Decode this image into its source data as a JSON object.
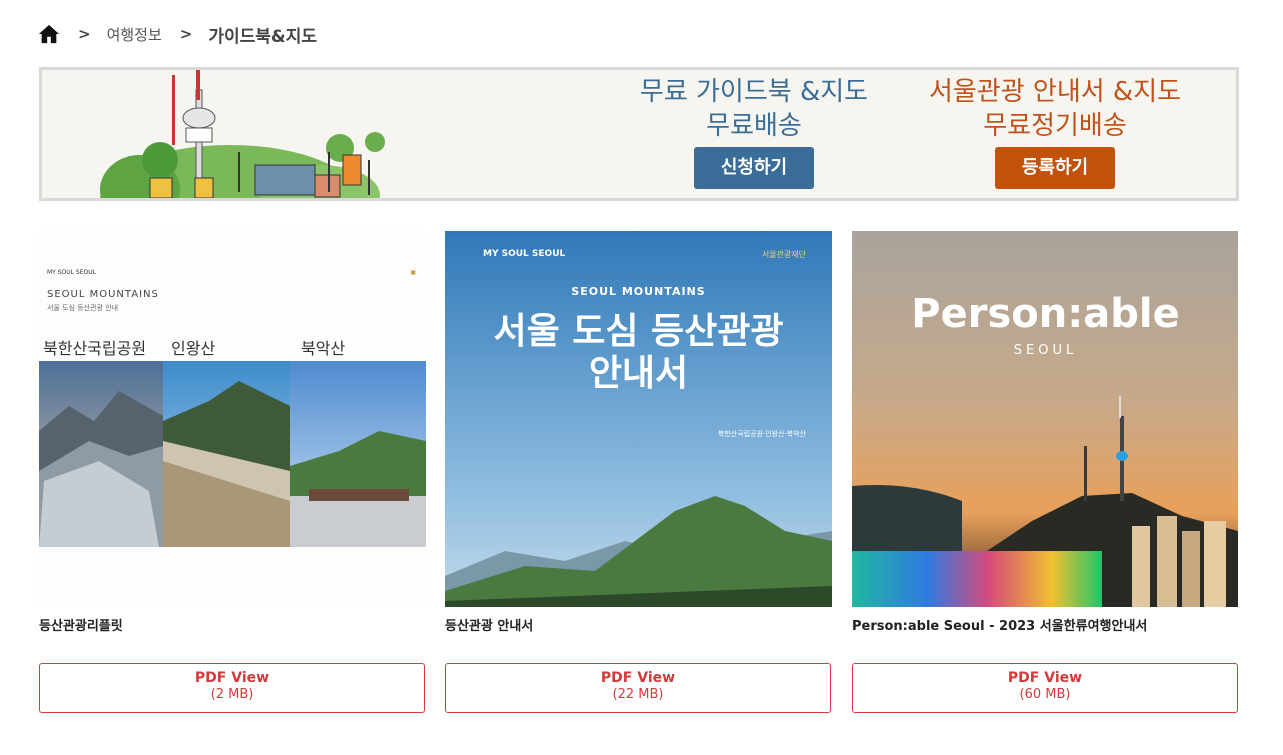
{
  "breadcrumb": {
    "separator": ">",
    "items": [
      "여행정보",
      "가이드북&지도"
    ]
  },
  "banner": {
    "promo_free": {
      "title_line1": "무료 가이드북 &지도",
      "title_line2": "무료배송",
      "button": "신청하기",
      "color": "#3a6e98"
    },
    "promo_regular": {
      "title_line1": "서울관광 안내서 &지도",
      "title_line2": "무료정기배송",
      "button": "등록하기",
      "color": "#c2520b"
    }
  },
  "cards": [
    {
      "title": "등산관광리플릿",
      "pdf_label": "PDF View",
      "pdf_size": "(2 MB)",
      "cover": {
        "brand": "MY SOUL SEOUL",
        "subtitle": "SEOUL MOUNTAINS",
        "subtitle_ko": "서울 도심 등산관광 안내",
        "labels": [
          "북한산국립공원",
          "인왕산",
          "북악산"
        ]
      }
    },
    {
      "title": "등산관광 안내서",
      "pdf_label": "PDF View",
      "pdf_size": "(22 MB)",
      "cover": {
        "brand": "MY SOUL SEOUL",
        "brand_right": "서울관광재단",
        "subtitle": "SEOUL MOUNTAINS",
        "title_line1": "서울 도심 등산관광",
        "title_line2": "안내서",
        "small": "북한산국립공원·인왕산·북악산"
      }
    },
    {
      "title": "Person:able Seoul - 2023 서울한류여행안내서",
      "pdf_label": "PDF View",
      "pdf_size": "(60 MB)",
      "cover": {
        "title": "Person:able",
        "subtitle": "SEOUL"
      }
    }
  ],
  "colors": {
    "pdf_border": "#d23b3b",
    "banner_bg": "#f6f5f0"
  }
}
